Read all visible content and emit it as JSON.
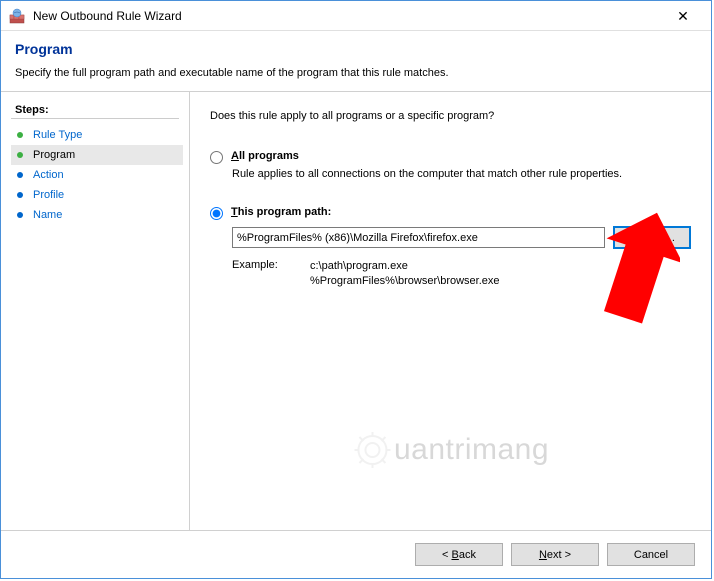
{
  "window": {
    "title": "New Outbound Rule Wizard"
  },
  "header": {
    "title": "Program",
    "description": "Specify the full program path and executable name of the program that this rule matches."
  },
  "sidebar": {
    "label": "Steps:",
    "items": [
      {
        "label": "Rule Type"
      },
      {
        "label": "Program"
      },
      {
        "label": "Action"
      },
      {
        "label": "Profile"
      },
      {
        "label": "Name"
      }
    ]
  },
  "content": {
    "prompt": "Does this rule apply to all programs or a specific program?",
    "all_programs": {
      "prefix": "A",
      "suffix": "ll programs",
      "description": "Rule applies to all connections on the computer that match other rule properties."
    },
    "this_path": {
      "prefix": "T",
      "suffix": "his program path:"
    },
    "path_value": "%ProgramFiles% (x86)\\Mozilla Firefox\\firefox.exe",
    "browse_label": "Browse...",
    "example_label": "Example:",
    "example_line1": "c:\\path\\program.exe",
    "example_line2": "%ProgramFiles%\\browser\\browser.exe"
  },
  "footer": {
    "back_prefix": "< ",
    "back_ul": "B",
    "back_suffix": "ack",
    "next_ul": "N",
    "next_suffix": "ext >",
    "cancel": "Cancel"
  },
  "watermark": {
    "text": "uantrimang"
  }
}
